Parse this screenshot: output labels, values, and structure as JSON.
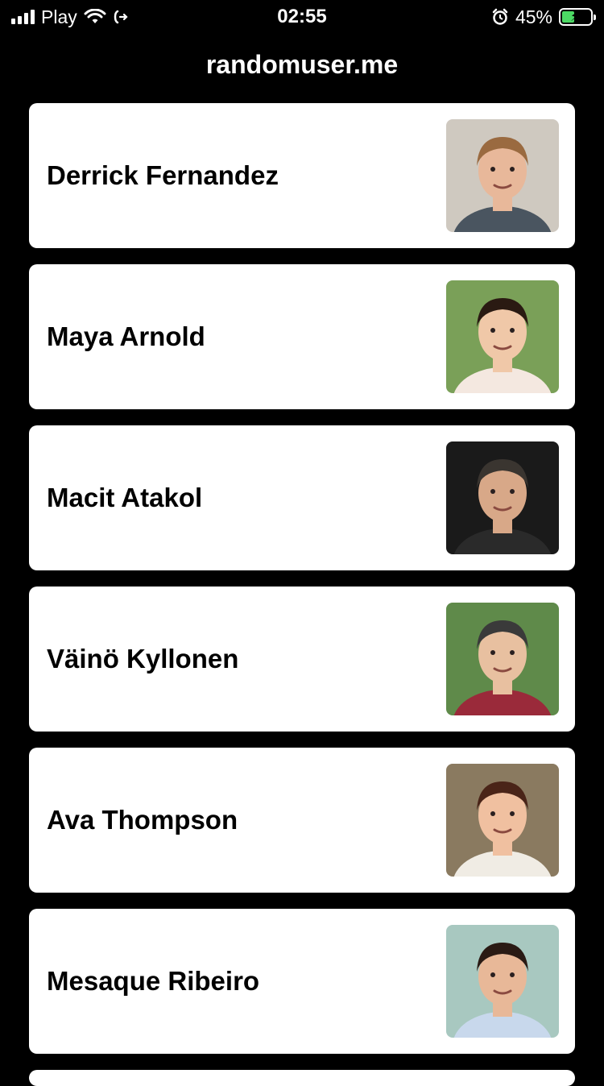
{
  "status_bar": {
    "carrier": "Play",
    "time": "02:55",
    "battery_percent": "45%",
    "battery_level": 0.45,
    "icons": [
      "signal-icon",
      "wifi-icon",
      "call-forward-icon",
      "alarm-icon",
      "battery-charging-icon"
    ]
  },
  "header": {
    "title": "randomuser.me"
  },
  "users": [
    {
      "name": "Derrick Fernandez",
      "avatar": {
        "bg": "#cfc9c0",
        "skin": "#e8b89a",
        "hair": "#9a6a40",
        "shirt": "#4a5560"
      }
    },
    {
      "name": "Maya Arnold",
      "avatar": {
        "bg": "#7aa058",
        "skin": "#f0c8a8",
        "hair": "#2a1a12",
        "shirt": "#f4e8e0"
      }
    },
    {
      "name": "Macit Atakol",
      "avatar": {
        "bg": "#1a1a1a",
        "skin": "#d8a888",
        "hair": "#3a3530",
        "shirt": "#2a2a2a"
      }
    },
    {
      "name": "Väinö Kyllonen",
      "avatar": {
        "bg": "#5f8a4a",
        "skin": "#e8c0a0",
        "hair": "#3a3a3a",
        "shirt": "#9a2a3a"
      }
    },
    {
      "name": "Ava Thompson",
      "avatar": {
        "bg": "#8a7a60",
        "skin": "#f0c0a0",
        "hair": "#4a2418",
        "shirt": "#f0ece4"
      }
    },
    {
      "name": "Mesaque Ribeiro",
      "avatar": {
        "bg": "#a8c8c0",
        "skin": "#e8b898",
        "hair": "#2a1a14",
        "shirt": "#c8d8ec"
      }
    }
  ]
}
